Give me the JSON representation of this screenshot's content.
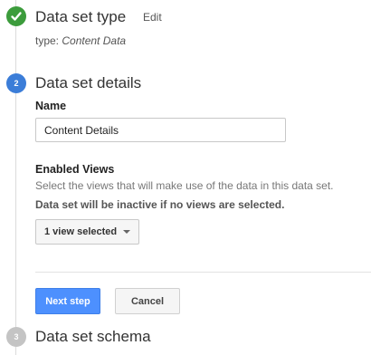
{
  "steps": [
    {
      "number": "1",
      "title": "Data set type",
      "status": "completed",
      "edit_label": "Edit",
      "type_prefix": "type:",
      "type_value": "Content Data"
    },
    {
      "number": "2",
      "title": "Data set details",
      "status": "active"
    },
    {
      "number": "3",
      "title": "Data set schema",
      "status": "pending"
    }
  ],
  "details": {
    "name_label": "Name",
    "name_value": "Content Details",
    "views_label": "Enabled Views",
    "views_description": "Select the views that will make use of the data in this data set.",
    "views_warning": "Data set will be inactive if no views are selected.",
    "views_dropdown": "1 view selected"
  },
  "actions": {
    "next_label": "Next step",
    "cancel_label": "Cancel"
  },
  "colors": {
    "completed": "#3c9c3c",
    "active": "#3b7dd8",
    "pending": "#c4c4c4",
    "primary_button": "#4d90fe"
  },
  "icons": {
    "completed": "check-icon"
  }
}
